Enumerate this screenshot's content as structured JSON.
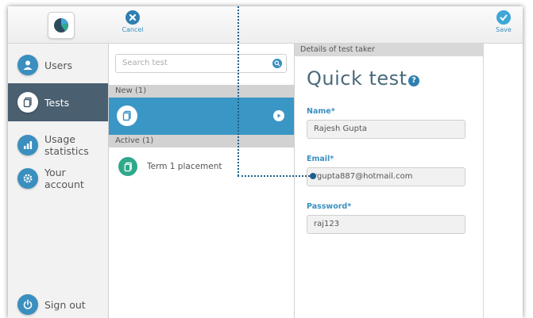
{
  "toolbar": {
    "cancel_label": "Cancel",
    "save_label": "Save"
  },
  "sidebar": {
    "items": [
      {
        "label": "Users",
        "icon": "user-icon"
      },
      {
        "label": "Tests",
        "icon": "document-icon",
        "active": true
      },
      {
        "label_line1": "Usage",
        "label_line2": "statistics",
        "icon": "bar-chart-icon"
      },
      {
        "label": "Your account",
        "icon": "gear-icon"
      }
    ],
    "sign_out_label": "Sign out"
  },
  "list": {
    "search_placeholder": "Search test",
    "new_header": "New (1)",
    "active_header": "Active (1)",
    "active_items": [
      {
        "label": "Term 1 placement"
      }
    ]
  },
  "details": {
    "header": "Details of test taker",
    "title": "Quick test",
    "name_label": "Name*",
    "name_value": "Rajesh Gupta",
    "email_label": "Email*",
    "email_value": "rgupta887@hotmail.com",
    "password_label": "Password*",
    "password_value": "raj123"
  },
  "colors": {
    "accent": "#3a8fbf",
    "sidebar_active": "#4a5f70",
    "new_row": "#3a96c4",
    "test_icon": "#2fa98b",
    "callout": "#1f5f8b"
  }
}
